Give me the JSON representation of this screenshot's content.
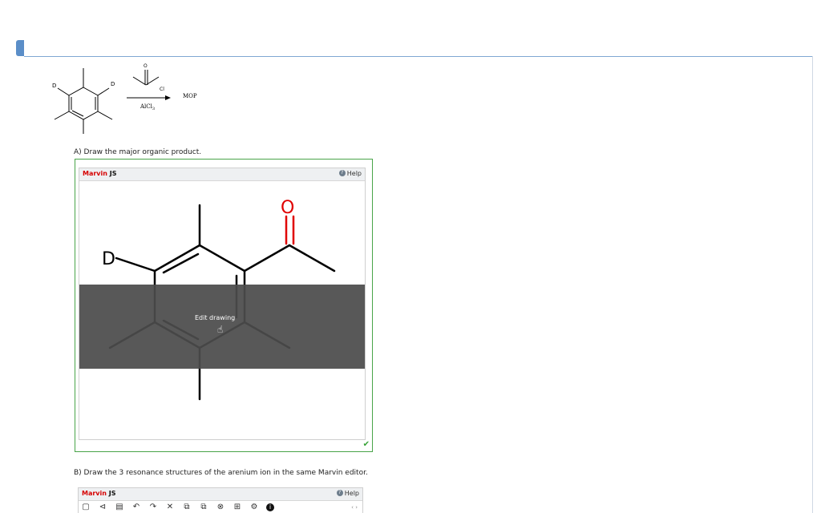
{
  "reaction": {
    "substituent_label": "D",
    "reagent_atoms": {
      "oxygen": "O",
      "chlorine": "Cl"
    },
    "catalyst": "AlCl",
    "catalyst_subscript": "3",
    "product_label": "MOP"
  },
  "question_a": {
    "prompt": "A) Draw the major organic product.",
    "editor": {
      "brand": "Marvin",
      "brand_suffix": " JS",
      "help_label": "Help",
      "edit_label": "Edit drawing",
      "atom_d": "D",
      "atom_o": "O",
      "status": "correct"
    }
  },
  "question_b": {
    "prompt": "B) Draw the 3 resonance structures of the arenium ion in the same Marvin editor.",
    "editor": {
      "brand": "Marvin",
      "brand_suffix": " JS",
      "help_label": "Help",
      "toolbar": [
        "new-document",
        "open",
        "save",
        "undo",
        "redo",
        "delete",
        "copy",
        "paste",
        "zoom",
        "2D-clean",
        "settings",
        "info"
      ]
    }
  },
  "colors": {
    "accent_blue": "#5b8ec8",
    "correct_green": "#49a449",
    "brand_red": "#d60000",
    "oxygen_red": "#e00000",
    "overlay_gray": "#4b4b4b"
  }
}
